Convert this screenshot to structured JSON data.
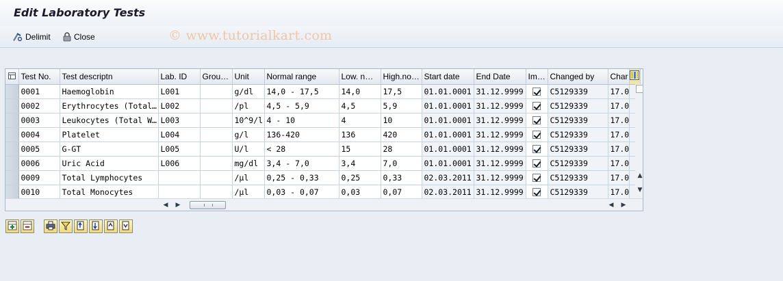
{
  "window": {
    "title": "Edit Laboratory Tests"
  },
  "toolbar": {
    "delimit_label": "Delimit",
    "close_label": "Close",
    "watermark": "© www.tutorialkart.com"
  },
  "grid": {
    "columns": [
      "Test No.",
      "Test descriptn",
      "Lab. ID",
      "Grou…",
      "Unit",
      "Normal range",
      "Low. n…",
      "High.no…",
      "Start date",
      "End Date",
      "Im…",
      "Changed by",
      "Char"
    ],
    "rows": [
      {
        "test_no": "0001",
        "desc": "Haemoglobin",
        "lab_id": "L001",
        "group": "",
        "unit": "g/dl",
        "range": "14,0 - 17,5",
        "low": "14,0",
        "high": "17,5",
        "start": "01.01.0001",
        "end": "31.12.9999",
        "imported": true,
        "changed_by": "C5129339",
        "changed_on": "17.0"
      },
      {
        "test_no": "0002",
        "desc": "Erythrocytes (Total…",
        "lab_id": "L002",
        "group": "",
        "unit": "/pl",
        "range": "4,5 - 5,9",
        "low": "4,5",
        "high": "5,9",
        "start": "01.01.0001",
        "end": "31.12.9999",
        "imported": true,
        "changed_by": "C5129339",
        "changed_on": "17.0"
      },
      {
        "test_no": "0003",
        "desc": "Leukocytes (Total W…",
        "lab_id": "L003",
        "group": "",
        "unit": "10^9/l",
        "range": "4 - 10",
        "low": "4",
        "high": "10",
        "start": "01.01.0001",
        "end": "31.12.9999",
        "imported": true,
        "changed_by": "C5129339",
        "changed_on": "17.0"
      },
      {
        "test_no": "0004",
        "desc": "Platelet",
        "lab_id": "L004",
        "group": "",
        "unit": "g/l",
        "range": "136-420",
        "low": "136",
        "high": "420",
        "start": "01.01.0001",
        "end": "31.12.9999",
        "imported": true,
        "changed_by": "C5129339",
        "changed_on": "17.0"
      },
      {
        "test_no": "0005",
        "desc": "G-GT",
        "lab_id": "L005",
        "group": "",
        "unit": "U/l",
        "range": "< 28",
        "low": "15",
        "high": "28",
        "start": "01.01.0001",
        "end": "31.12.9999",
        "imported": true,
        "changed_by": "C5129339",
        "changed_on": "17.0"
      },
      {
        "test_no": "0006",
        "desc": "Uric Acid",
        "lab_id": "L006",
        "group": "",
        "unit": "mg/dl",
        "range": "3,4 - 7,0",
        "low": "3,4",
        "high": "7,0",
        "start": "01.01.0001",
        "end": "31.12.9999",
        "imported": true,
        "changed_by": "C5129339",
        "changed_on": "17.0"
      },
      {
        "test_no": "0009",
        "desc": "Total Lymphocytes",
        "lab_id": "",
        "group": "",
        "unit": "/µl",
        "range": "0,25 - 0,33",
        "low": "0,25",
        "high": "0,33",
        "start": "02.03.2011",
        "end": "31.12.9999",
        "imported": true,
        "changed_by": "C5129339",
        "changed_on": "17.0"
      },
      {
        "test_no": "0010",
        "desc": "Total Monocytes",
        "lab_id": "",
        "group": "",
        "unit": "/µl",
        "range": "0,03 - 0,07",
        "low": "0,03",
        "high": "0,07",
        "start": "02.03.2011",
        "end": "31.12.9999",
        "imported": true,
        "changed_by": "C5129339",
        "changed_on": "17.0"
      }
    ]
  },
  "bottom_toolbar": {
    "icons": [
      "insert-row-icon",
      "delete-row-icon",
      "print-icon",
      "filter-icon",
      "sort-ascending-icon",
      "sort-descending-icon",
      "page-up-icon",
      "page-down-icon"
    ]
  }
}
